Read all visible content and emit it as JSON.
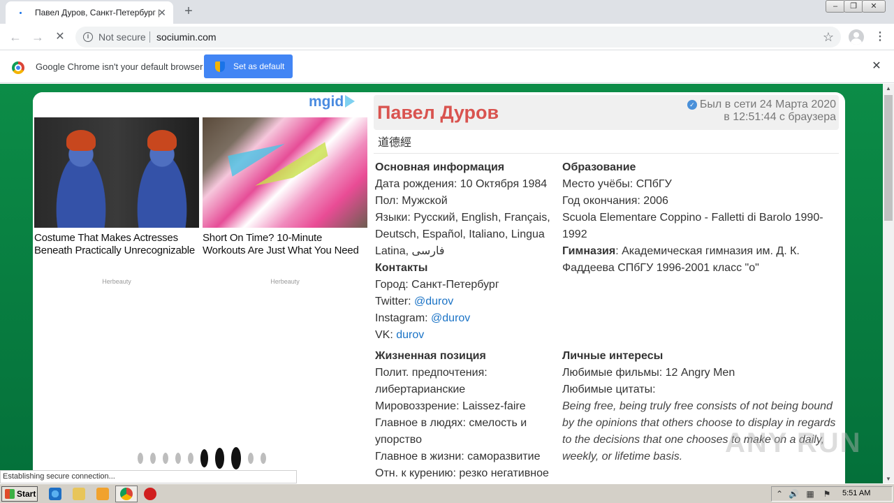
{
  "browser": {
    "tab_title": "Павел Дуров, Санкт-Петербург | I",
    "tab_close": "✕",
    "new_tab": "+",
    "window_controls": [
      "–",
      "❐",
      "✕"
    ],
    "nav": {
      "back": "←",
      "forward": "→",
      "reload": "✕"
    },
    "address": {
      "security": "Not secure",
      "url": "sociumin.com",
      "info_icon": "i",
      "bookmark": "☆"
    },
    "menu": "⋮"
  },
  "infobar": {
    "text": "Google Chrome isn't your default browser",
    "button": "Set as default",
    "close": "✕"
  },
  "ad": {
    "brand": "mgid",
    "items": [
      {
        "title": "Costume That Makes Actresses Beneath Practically Unrecognizable",
        "source": "Herbeauty"
      },
      {
        "title": "Short On Time? 10-Minute Workouts Are Just What You Need",
        "source": "Herbeauty"
      }
    ]
  },
  "profile": {
    "name": "Павел Дуров",
    "status_line1": "Был в сети 24 Марта 2020",
    "status_line2": "в 12:51:44 с браузера",
    "motto": "道德經",
    "basic": {
      "title": "Основная информация",
      "birth": "Дата рождения: 10 Октября 1984",
      "gender": "Пол: Мужской",
      "langs1": "Языки: Русский, English, Français,",
      "langs2": "Deutsch, Español, Italiano, Lingua",
      "langs3": "Latina, فارسی"
    },
    "contacts": {
      "title": "Контакты",
      "city": "Город: Санкт-Петербург",
      "twitter_label": "Twitter: ",
      "twitter": "@durov",
      "instagram_label": "Instagram: ",
      "instagram": "@durov",
      "vk_label": "VK: ",
      "vk": "durov"
    },
    "education": {
      "title": "Образование",
      "place": "Место учёбы: СПбГУ",
      "year": "Год окончания: 2006",
      "school1": "Scuola Elementare Coppino - Falletti di Barolo 1990-",
      "school2": "1992",
      "gym_label": "Гимназия",
      "gym1": ": Академическая гимназия им. Д. К.",
      "gym2": "Фаддеева СПбГУ 1996-2001 класс \"о\""
    },
    "life": {
      "title": "Жизненная позиция",
      "pol1": "Полит. предпочтения:",
      "pol2": "либертарианские",
      "world": "Мировоззрение: Laissez-faire",
      "people1": "Главное в людях: смелость и",
      "people2": "упорство",
      "main": "Главное в жизни: саморазвитие",
      "smoke": "Отн. к курению: резко негативное"
    },
    "interests": {
      "title": "Личные интересы",
      "films": "Любимые фильмы: 12 Angry Men",
      "quotes": "Любимые цитаты:",
      "q1": "Being free, being truly free consists of not being bound",
      "q2": "by the opinions that others choose to display in regards",
      "q3": "to the decisions that one chooses to make on a daily,",
      "q4": "weekly, or lifetime basis."
    }
  },
  "status_bar": "Establishing secure connection...",
  "watermark": "ANY RUN",
  "taskbar": {
    "start": "Start",
    "clock": "5:51 AM",
    "tray": [
      "⌃",
      "🔊",
      "▦",
      "⚑"
    ]
  },
  "colors": {
    "page_bg": "#0c8c47",
    "name": "#d9534f",
    "link": "#1a73c6",
    "button": "#4285f4"
  }
}
